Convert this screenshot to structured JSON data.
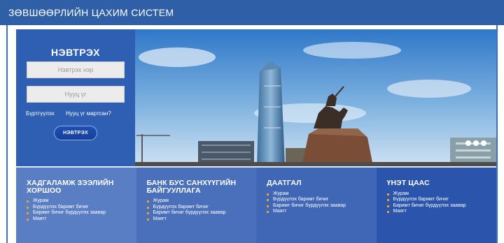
{
  "header": {
    "title": "ЗӨВШӨӨРЛИЙН ЦАХИМ СИСТЕМ"
  },
  "login": {
    "title": "НЭВТРЭХ",
    "username_placeholder": "Нэвтрэх нэр",
    "password_placeholder": "Нууц үг",
    "register_link": "Бүртгүүлэх",
    "forgot_link": "Нууц үг мартсан?",
    "submit_label": "НЭВТРЭХ"
  },
  "categories": [
    {
      "title_line1": "ХАДГАЛАМЖ ЗЭЭЛИЙН",
      "title_line2": "ХОРШОО",
      "items": [
        "Журам",
        "Бүрдүүлэх баримт бичиг",
        "Баримт бичиг бүрдүүлэх заавар",
        "Маягт"
      ]
    },
    {
      "title_line1": "БАНК БУС САНХҮҮГИЙН",
      "title_line2": "БАЙГУУЛЛАГА",
      "items": [
        "Журам",
        "Бүрдүүлэх баримт бичиг",
        "Баримт бичиг бүрдүүлэх заавар",
        "Маягт"
      ]
    },
    {
      "title_line1": "ДААТГАЛ",
      "title_line2": "",
      "items": [
        "Журам",
        "Бүрдүүлэх баримт бичиг",
        "Баримт бичиг бүрдүүлэх заавар",
        "Маягт"
      ]
    },
    {
      "title_line1": "ҮНЭТ ЦААС",
      "title_line2": "",
      "items": [
        "Журам",
        "Бүрдүүлэх баримт бичиг",
        "Баримт бичиг бүрдүүлэх заавар",
        "Маягт"
      ]
    }
  ],
  "icons": {
    "bullet": "square-bullet-icon",
    "slider_dots": "slider-dot-icon"
  },
  "colors": {
    "header": "#2f5fa7",
    "login_panel": "#2f5fb3",
    "bullet": "#f0a21a"
  }
}
